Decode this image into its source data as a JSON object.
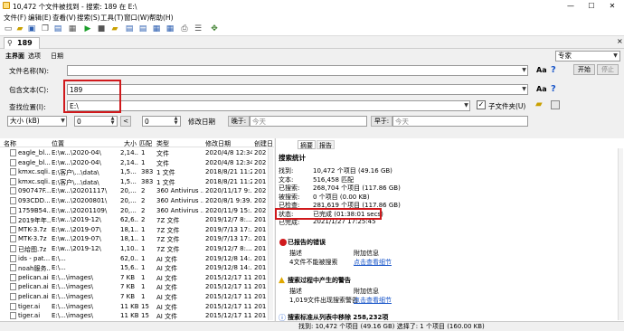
{
  "window": {
    "title": "10,472 个文件被找到 - 搜索: 189 在 E:\\",
    "minimize": "—",
    "maximize": "☐",
    "close": "✕"
  },
  "menu": [
    "文件(F)",
    "编辑(E)",
    "查看(V)",
    "搜索(S)",
    "工具(T)",
    "窗口(W)",
    "帮助(H)"
  ],
  "doc_tab": {
    "label": "189",
    "close": "×"
  },
  "ribbon_tabs": [
    "主界面",
    "选项",
    "日期"
  ],
  "form": {
    "filename_label": "文件名称(N):",
    "filename_value": "",
    "content_label": "包含文本(C):",
    "content_value": "189",
    "location_label": "查找位置(I):",
    "location_value": "E:\\",
    "subfolder_label": "子文件夹(U)",
    "size_op": "大小 (kB)",
    "size_left": "0",
    "size_lt": "<",
    "size_right": "0",
    "date_label": "修改日期",
    "date_from_op": "晚于:",
    "date_from": "今天",
    "date_to_op": "早于:",
    "date_to": "今天"
  },
  "mode": {
    "value": "专家",
    "start": "开始",
    "stop": "停止"
  },
  "list": {
    "columns": [
      "名称",
      "位置",
      "大小",
      "匹配",
      "类型",
      "修改日期",
      "创建日"
    ],
    "rows": [
      [
        "eagle_bl...",
        "E:\\w...\\2020-04\\",
        "2,14...",
        "1",
        "文件",
        "2020/4/8 12:34...",
        "202"
      ],
      [
        "eagle_bl...",
        "E:\\w...\\2020-04\\",
        "2,14...",
        "1",
        "文件",
        "2020/4/8 12:34...",
        "202"
      ],
      [
        "kmxc.sqli...",
        "E:\\客户\\...\\data\\",
        "1,5...",
        "383",
        "1 文件",
        "2018/8/21 11:2...",
        "201"
      ],
      [
        "kmxc.sqli...",
        "E:\\客户\\...\\data\\",
        "1,5...",
        "383",
        "1 文件",
        "2018/8/21 11:2...",
        "201"
      ],
      [
        "090747F...",
        "E:\\w...\\20201117\\",
        "20,...",
        "2",
        "360 Antivirus ...",
        "2020/11/17 9:...",
        "202"
      ],
      [
        "093CDD...",
        "E:\\w...\\20200801\\",
        "20,...",
        "2",
        "360 Antivirus ...",
        "2020/8/1 9:39...",
        "202"
      ],
      [
        "1759B54...",
        "E:\\w...\\20201109\\",
        "20,...",
        "2",
        "360 Antivirus ...",
        "2020/11/9 15:...",
        "202"
      ],
      [
        "2019年年...",
        "E:\\w...\\2019-12\\",
        "62,6...",
        "2",
        "7Z 文件",
        "2019/12/7 8:...",
        "201"
      ],
      [
        "MTK-3.7z",
        "E:\\w...\\2019-07\\",
        "18,1...",
        "1",
        "7Z 文件",
        "2019/7/13 17:...",
        "201"
      ],
      [
        "MTK-3.7z",
        "E:\\w...\\2019-07\\",
        "18,1...",
        "1",
        "7Z 文件",
        "2019/7/13 17:...",
        "201"
      ],
      [
        "已给图.7z",
        "E:\\w...\\2019-12\\",
        "1,10...",
        "1",
        "7Z 文件",
        "2019/12/7 8:...",
        "201"
      ],
      [
        "ids - pat...",
        "E:\\...",
        "62,0...",
        "1",
        "AI 文件",
        "2019/12/8 14:...",
        "201"
      ],
      [
        "noah服务...",
        "E:\\...",
        "15,6...",
        "1",
        "AI 文件",
        "2019/12/8 14:...",
        "201"
      ],
      [
        "pelican.ai",
        "E:\\...\\images\\",
        "7 KB",
        "1",
        "AI 文件",
        "2015/12/17 11:...",
        "201"
      ],
      [
        "pelican.ai",
        "E:\\...\\images\\",
        "7 KB",
        "1",
        "AI 文件",
        "2015/12/17 11:...",
        "201"
      ],
      [
        "pelican.ai",
        "E:\\...\\images\\",
        "7 KB",
        "1",
        "AI 文件",
        "2015/12/17 11:...",
        "201"
      ],
      [
        "tiger.ai",
        "E:\\...\\images\\",
        "11 KB",
        "15",
        "AI 文件",
        "2015/12/17 11:...",
        "201"
      ],
      [
        "tiger.ai",
        "E:\\...\\images\\",
        "11 KB",
        "15",
        "AI 文件",
        "2015/12/17 11:...",
        "201"
      ]
    ]
  },
  "right_tabs": [
    "摘要",
    "报告"
  ],
  "summary": {
    "heading": "搜索统计",
    "items": [
      [
        "找到:",
        "10,472 个项目 (49.16 GB)"
      ],
      [
        "文本:",
        "516,458 匹配"
      ],
      [
        "已搜索:",
        "268,704 个项目 (117.86 GB)"
      ],
      [
        "被搜索:",
        "0 个项目 (0.00 KB)"
      ],
      [
        "已检查:",
        "281,619 个项目 (117.86 GB)"
      ],
      [
        "状态:",
        "已完成 (01:38:01 secs)"
      ],
      [
        "已完成:",
        "2021/1/27 17:25:45"
      ]
    ],
    "errors_heading": "已报告的错误",
    "errors_cols": [
      "描述",
      "附加信息"
    ],
    "errors_row": [
      "4文件不能被搜索",
      "点击查看细节"
    ],
    "warn_heading": "搜索过程中产生的警告",
    "warn_cols": [
      "描述",
      "附加信息"
    ],
    "warn_row": [
      "1,019文件出现搜索警告",
      "点击查看细节"
    ],
    "index_heading": "搜索标准从列表中移除 258,232项"
  },
  "status": {
    "text": "找到: 10,472 个项目 (49.16 GB)      选择了: 1 个项目 (160.00 KB)"
  }
}
